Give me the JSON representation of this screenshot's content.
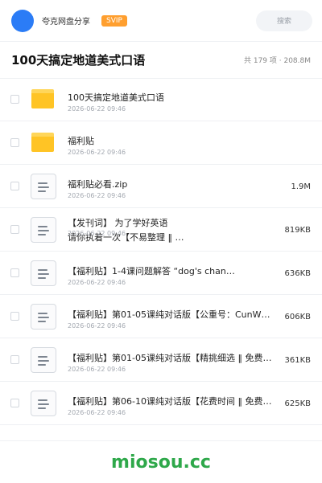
{
  "topbar": {
    "brand": "夸克网盘分享",
    "badge": "SVIP",
    "search_label": "搜索"
  },
  "header": {
    "title": "100天搞定地道美式口语",
    "summary": "共 179 项 · 208.8M"
  },
  "items": [
    {
      "type": "folder",
      "name": "100天搞定地道美式口语",
      "date": "2026-06-22 09:46",
      "size": ""
    },
    {
      "type": "folder",
      "name": "福利贴",
      "date": "2026-06-22 09:46",
      "size": ""
    },
    {
      "type": "file",
      "name": "福利贴必看.zip",
      "date": "2026-06-22 09:46",
      "size": "1.9M"
    },
    {
      "type": "file",
      "name": "【发刊词】 为了学好英语\n请你执着一次【不易整理 ‖ …",
      "date": "2026-06-22 09:46",
      "size": "819KB"
    },
    {
      "type": "file",
      "name": "【福利贴】1-4课问题解答 “dog's chan…",
      "date": "2026-06-22 09:46",
      "size": "636KB"
    },
    {
      "type": "file",
      "name": "【福利贴】第01-05课纯对话版【公重号：CunW…",
      "date": "2026-06-22 09:46",
      "size": "606KB"
    },
    {
      "type": "file",
      "name": "【福利贴】第01-05课纯对话版【精挑细选 ‖ 免费提…",
      "date": "2026-06-22 09:46",
      "size": "361KB"
    },
    {
      "type": "file",
      "name": "【福利贴】第06-10课纯对话版【花费时间 ‖ 免费获…",
      "date": "2026-06-22 09:46",
      "size": "625KB"
    }
  ],
  "watermark": "miosou.cc",
  "colors": {
    "accent": "#2b7cf6",
    "badge": "#ff9f2f",
    "folder": "#ffc425",
    "watermark": "#2ea84a"
  }
}
